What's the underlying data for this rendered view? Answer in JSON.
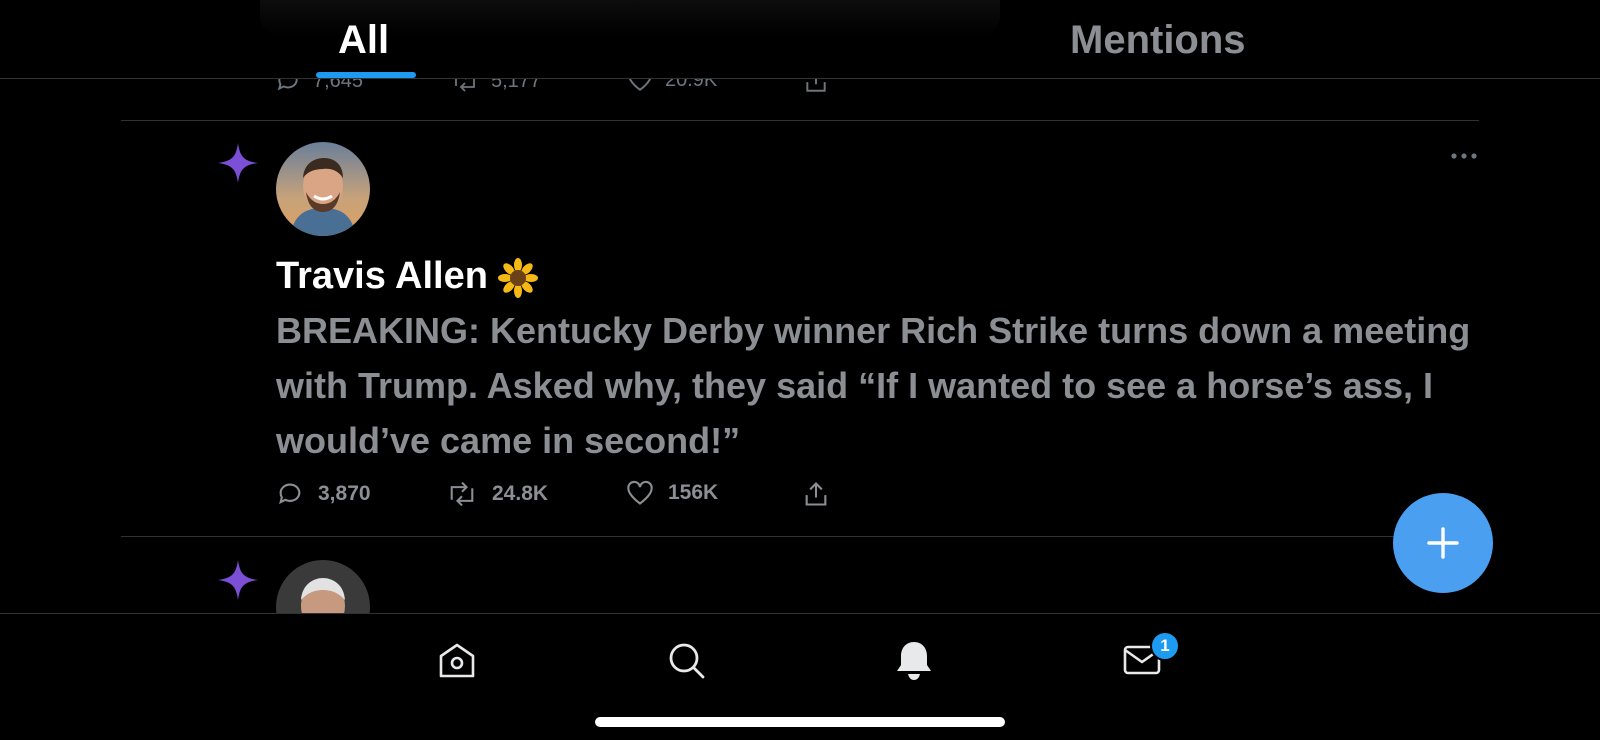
{
  "tabs": {
    "all": "All",
    "mentions": "Mentions"
  },
  "prev_tweet": {
    "replies": "7,645",
    "retweets": "5,177",
    "likes": "20.9K"
  },
  "tweet": {
    "author": "Travis Allen",
    "author_emoji": "sunflower-icon",
    "text": "BREAKING: Kentucky Derby winner Rich Strike turns down a meeting with Trump. Asked why, they said “If I wanted to see a horse’s ass, I would’ve came in second!”",
    "replies": "3,870",
    "retweets": "24.8K",
    "likes": "156K"
  },
  "fab_icon": "plus-icon",
  "nav": {
    "items": [
      "home-icon",
      "search-icon",
      "notifications-icon",
      "messages-icon"
    ],
    "messages_badge": "1"
  },
  "colors": {
    "accent": "#1d9bf0",
    "fab": "#4a9ff0",
    "spark": "#7b4fd6",
    "background": "#000000"
  }
}
